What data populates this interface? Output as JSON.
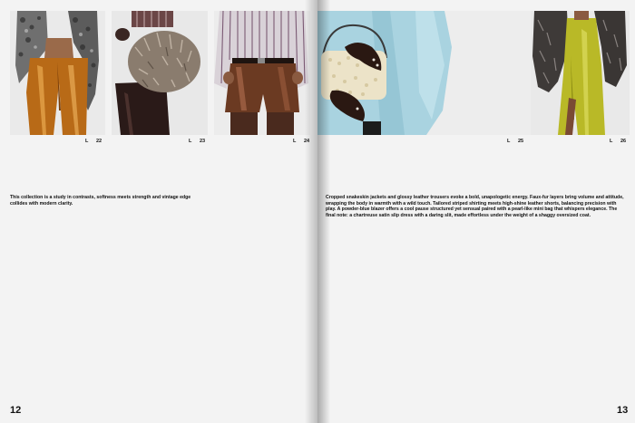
{
  "spread": {
    "left_page": {
      "page_number": "12",
      "body_text": "This collection is a study in contrasts, softness meets strength and vintage edge collides with modern clarity.",
      "looks": [
        {
          "prefix": "L",
          "number": "22"
        },
        {
          "prefix": "L",
          "number": "23"
        },
        {
          "prefix": "L",
          "number": "24"
        }
      ]
    },
    "right_page": {
      "page_number": "13",
      "body_text": "Cropped snakeskin jackets and glossy leather trousers evoke a bold, unapologetic energy. Faux-fur layers bring volume and attitude, wrapping the body in warmth with a wild touch. Tailored striped shirting meets high-shine leather shorts, balancing precision with play. A powder-blue blazer offers a cool pause structured yet sensual paired with a pearl-like mini bag that whispers elegance. The final note: a chartreuse satin slip dress with a daring slit, made effortless under the weight of a shaggy oversized coat.",
      "looks": [
        {
          "prefix": "L",
          "number": "25"
        },
        {
          "prefix": "L",
          "number": "26"
        }
      ]
    }
  }
}
